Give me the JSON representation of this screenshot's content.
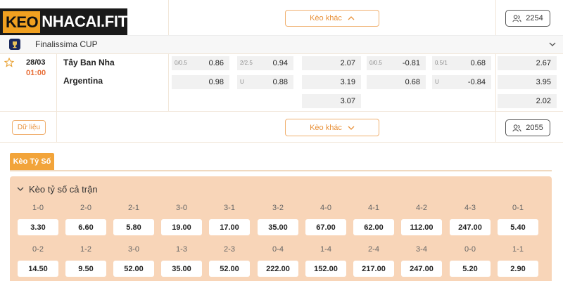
{
  "brand": {
    "prefix": "KEO",
    "suffix": "NHACAI.FIT"
  },
  "top": {
    "more_label": "Kèo khác",
    "count": "2254"
  },
  "league": {
    "name": "Finalissima CUP",
    "icon": "trophy-icon"
  },
  "match": {
    "date": "28/03",
    "time": "01:00",
    "home": "Tây Ban Nha",
    "away": "Argentina",
    "odds": {
      "hdp_ft": {
        "line": "0/0.5",
        "home": "0.86",
        "away": "0.98"
      },
      "ou_ft": {
        "line": "2/2.5",
        "over": "0.94",
        "under_label": "U",
        "under": "0.88"
      },
      "x12_ft": {
        "home": "2.07",
        "away": "3.19",
        "draw": "3.07"
      },
      "hdp_h1": {
        "line": "0/0.5",
        "home": "-0.81",
        "away": "0.68"
      },
      "ou_h1": {
        "line": "0.5/1",
        "over": "0.68",
        "under_label": "U",
        "under": "-0.84"
      },
      "x12_h1": {
        "home": "2.67",
        "away": "3.95",
        "draw": "2.02"
      }
    },
    "data_label": "Dữ liệu",
    "more_label": "Kèo khác",
    "count": "2055"
  },
  "score_section": {
    "tab": "Kèo Tỷ Số",
    "title": "Kèo tỷ số cả trận",
    "row1": [
      {
        "score": "1-0",
        "odd": "3.30"
      },
      {
        "score": "2-0",
        "odd": "6.60"
      },
      {
        "score": "2-1",
        "odd": "5.80"
      },
      {
        "score": "3-0",
        "odd": "19.00"
      },
      {
        "score": "3-1",
        "odd": "17.00"
      },
      {
        "score": "3-2",
        "odd": "35.00"
      },
      {
        "score": "4-0",
        "odd": "67.00"
      },
      {
        "score": "4-1",
        "odd": "62.00"
      },
      {
        "score": "4-2",
        "odd": "112.00"
      },
      {
        "score": "4-3",
        "odd": "247.00"
      },
      {
        "score": "0-1",
        "odd": "5.40"
      }
    ],
    "row2": [
      {
        "score": "0-2",
        "odd": "14.50"
      },
      {
        "score": "1-2",
        "odd": "9.50"
      },
      {
        "score": "3-0",
        "odd": "52.00"
      },
      {
        "score": "1-3",
        "odd": "35.00"
      },
      {
        "score": "2-3",
        "odd": "52.00"
      },
      {
        "score": "0-4",
        "odd": "222.00"
      },
      {
        "score": "1-4",
        "odd": "152.00"
      },
      {
        "score": "2-4",
        "odd": "217.00"
      },
      {
        "score": "3-4",
        "odd": "247.00"
      },
      {
        "score": "0-0",
        "odd": "5.20"
      },
      {
        "score": "1-1",
        "odd": "2.90"
      }
    ]
  },
  "colors": {
    "accent": "#f2a43a",
    "accent_text": "#e8913a",
    "panel": "#f8d5b8",
    "time": "#e8703a"
  }
}
